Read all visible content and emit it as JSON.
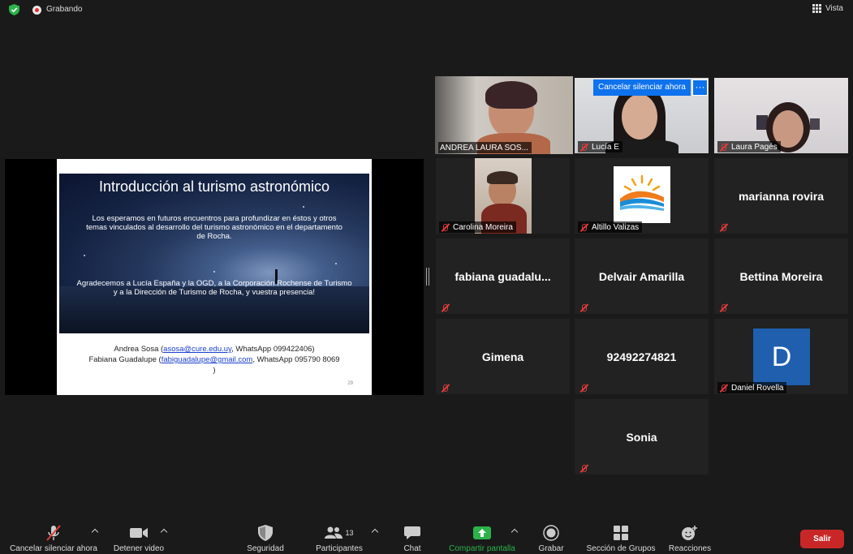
{
  "top_bar": {
    "recording_label": "Grabando",
    "view_label": "Vista"
  },
  "shared_slide": {
    "title": "Introducción al turismo astronómico",
    "paragraph1": "Los esperamos en futuros encuentros para profundizar en éstos y otros temas vinculados al desarrollo del turismo astronómico en el departamento de Rocha.",
    "paragraph2": "Agradecemos a Lucía España y la OGD, a la Corporación Rochense de Turismo y a la Dirección de Turismo de Rocha, y vuestra presencia!",
    "contact1_name": "Andrea Sosa (",
    "contact1_email": "asosa@cure.edu.uy",
    "contact1_rest": ", WhatsApp 099422406)",
    "contact2_name": "Fabiana Guadalupe (",
    "contact2_email": "fabiguadalupe@gmail.com",
    "contact2_rest": ", WhatsApp 095790 8069",
    "contact2_close": ")",
    "page_number": "29"
  },
  "unmute_prompt": {
    "label": "Cancelar silenciar ahora",
    "more": "···"
  },
  "participants": [
    {
      "name": "ANDREA LAURA SOS...",
      "video": true
    },
    {
      "name": "Lucía E",
      "video": true
    },
    {
      "name": "Laura Pagés",
      "video": true
    },
    {
      "name": "Carolina Moreira",
      "video": true
    },
    {
      "name": "Altillo Valizas",
      "video": false
    },
    {
      "name": "marianna rovira",
      "video": false
    },
    {
      "name": "fabiana  guadalu...",
      "video": false
    },
    {
      "name": "Delvair Amarilla",
      "video": false
    },
    {
      "name": "Bettina Moreira",
      "video": false
    },
    {
      "name": "Gimena",
      "video": false
    },
    {
      "name": "92492274821",
      "video": false
    },
    {
      "name": "Daniel Rovella",
      "avatar_letter": "D",
      "video": false
    },
    {
      "name": "Sonia",
      "video": false
    }
  ],
  "toolbar": {
    "mute": "Cancelar silenciar ahora",
    "video": "Detener video",
    "security": "Seguridad",
    "participants": "Participantes",
    "participants_count": "13",
    "chat": "Chat",
    "share": "Compartir pantalla",
    "record": "Grabar",
    "breakout": "Sección de Grupos",
    "reactions": "Reacciones",
    "leave": "Salir"
  },
  "colors": {
    "active_speaker": "#c7e34a",
    "share_green": "#2bb34a",
    "leave_red": "#c92727",
    "prompt_blue": "#0e72ed"
  }
}
